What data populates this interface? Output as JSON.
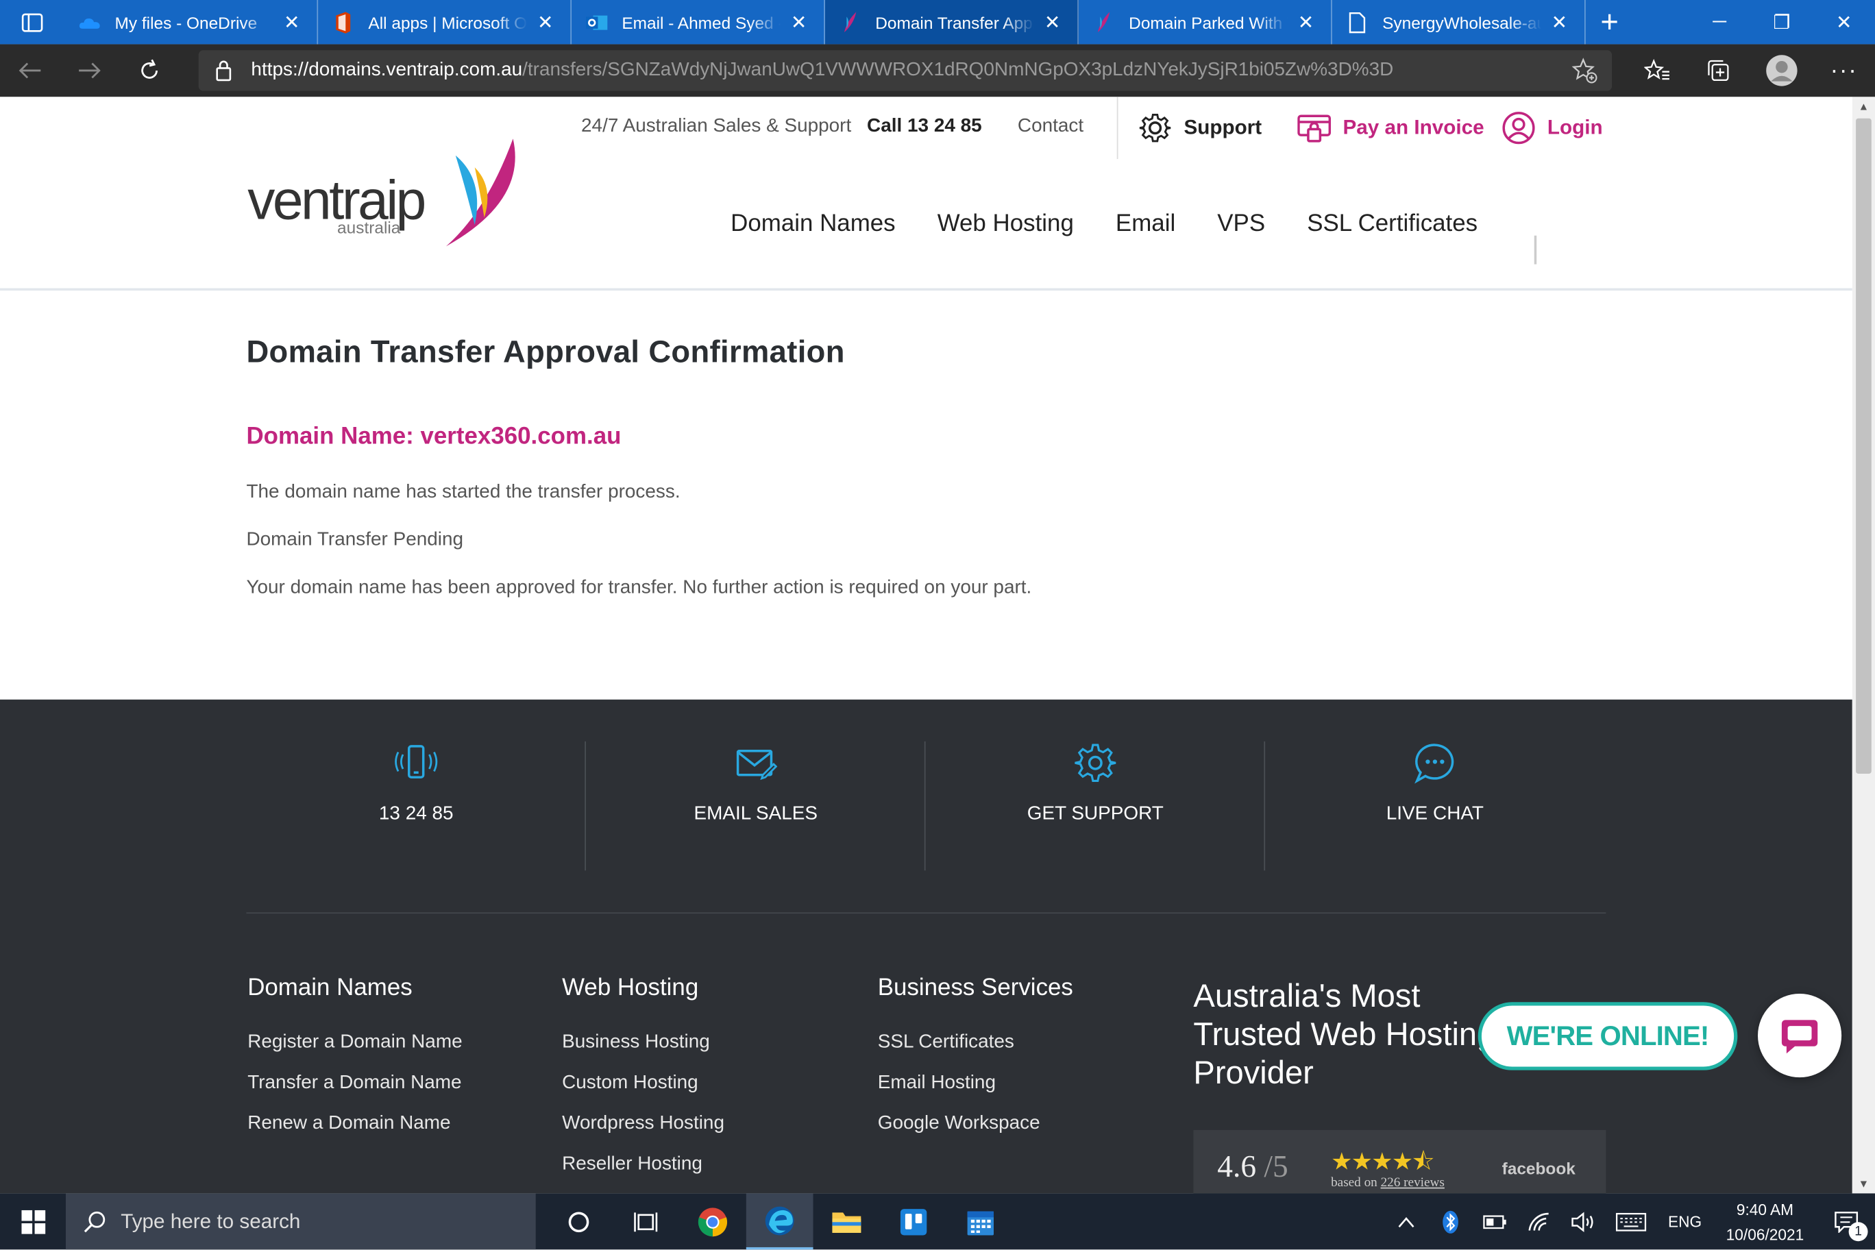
{
  "browser": {
    "tabs": [
      {
        "title": "My files - OneDrive",
        "active": false
      },
      {
        "title": "All apps | Microsoft Office",
        "active": false
      },
      {
        "title": "Email - Ahmed Syed - Outlook",
        "active": false
      },
      {
        "title": "Domain Transfer Approval",
        "active": true
      },
      {
        "title": "Domain Parked With VentraIP",
        "active": false
      },
      {
        "title": "SynergyWholesale-auth",
        "active": false
      }
    ],
    "url_host": "https://domains.ventraip.com.au",
    "url_path": "/transfers/SGNZaWdyNjJwanUwQ1VWWWROX1dRQ0NmNGpOX3pLdzNYekJySjR1bi05Zw%3D%3D"
  },
  "site": {
    "top_bar": {
      "sales_support": "24/7 Australian Sales & Support",
      "call": "Call  13 24 85",
      "contact": "Contact",
      "support": "Support",
      "pay_invoice": "Pay an Invoice",
      "login": "Login"
    },
    "logo": {
      "word": "ventraip",
      "sub": "australia"
    },
    "nav": [
      "Domain Names",
      "Web Hosting",
      "Email",
      "VPS",
      "SSL Certificates"
    ]
  },
  "content": {
    "heading": "Domain Transfer Approval Confirmation",
    "domain_line": "Domain Name: vertex360.com.au",
    "para1": "The domain name has started the transfer process.",
    "para2": "Domain Transfer Pending",
    "para3": "Your domain name has been approved for transfer. No further action is required on your part."
  },
  "footer": {
    "features": [
      {
        "label": "13 24 85",
        "icon": "phone-icon"
      },
      {
        "label": "EMAIL SALES",
        "icon": "email-icon"
      },
      {
        "label": "GET SUPPORT",
        "icon": "gear-icon"
      },
      {
        "label": "LIVE CHAT",
        "icon": "chat-icon"
      }
    ],
    "columns": [
      {
        "heading": "Domain Names",
        "links": [
          "Register a Domain Name",
          "Transfer a Domain Name",
          "Renew a Domain Name"
        ]
      },
      {
        "heading": "Web Hosting",
        "links": [
          "Business Hosting",
          "Custom Hosting",
          "Wordpress Hosting",
          "Reseller Hosting"
        ]
      },
      {
        "heading": "Business Services",
        "links": [
          "SSL Certificates",
          "Email Hosting",
          "Google Workspace"
        ]
      }
    ],
    "trust_title": "Australia's Most Trusted Web Hosting Provider",
    "rating": {
      "score": "4.6",
      "out_of": "/5",
      "stars": "★★★★⯪",
      "based_on": "based on",
      "reviews": "226 reviews",
      "source": "facebook"
    },
    "online_badge": "WE'RE ONLINE!"
  },
  "taskbar": {
    "search_placeholder": "Type here to search",
    "language": "ENG",
    "time": "9:40 AM",
    "date": "10/06/2021",
    "notification_count": "1"
  },
  "colors": {
    "brand_pink": "#c1257f",
    "footer_bg": "#2d3035",
    "accent_blue": "#29a8e0",
    "online_teal": "#20b2a4"
  }
}
